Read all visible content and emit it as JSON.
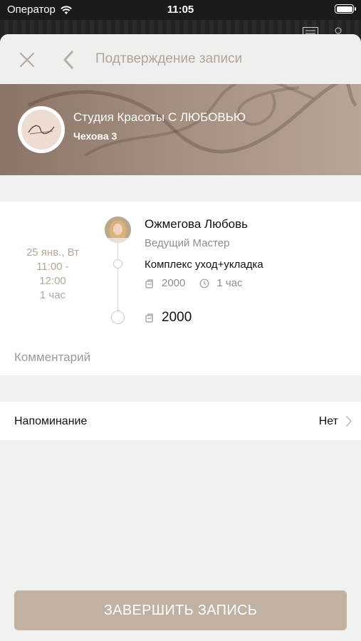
{
  "status_bar": {
    "carrier": "Оператор",
    "time": "11:05"
  },
  "nav": {
    "title": "Подтверждение записи"
  },
  "studio": {
    "name": "Студия Красоты С ЛЮБОВЬЮ",
    "address": "Чехова 3"
  },
  "appointment": {
    "date": "25 янв., Вт",
    "time_start": "11:00 -",
    "time_end": "12:00",
    "duration": "1 час",
    "master_name": "Ожмегова Любовь",
    "master_role": "Ведущий Мастер",
    "service_name": "Комплекс уход+укладка",
    "service_price": "2000",
    "service_duration": "1 час",
    "total": "2000"
  },
  "comment": {
    "placeholder": "Комментарий"
  },
  "reminder": {
    "label": "Напоминание",
    "value": "Нет"
  },
  "finish_button": {
    "label": "ЗАВЕРШИТЬ ЗАПИСЬ"
  },
  "colors": {
    "accent": "#c0b1a3",
    "title": "#b0a495",
    "banner": "#a38d7f"
  }
}
